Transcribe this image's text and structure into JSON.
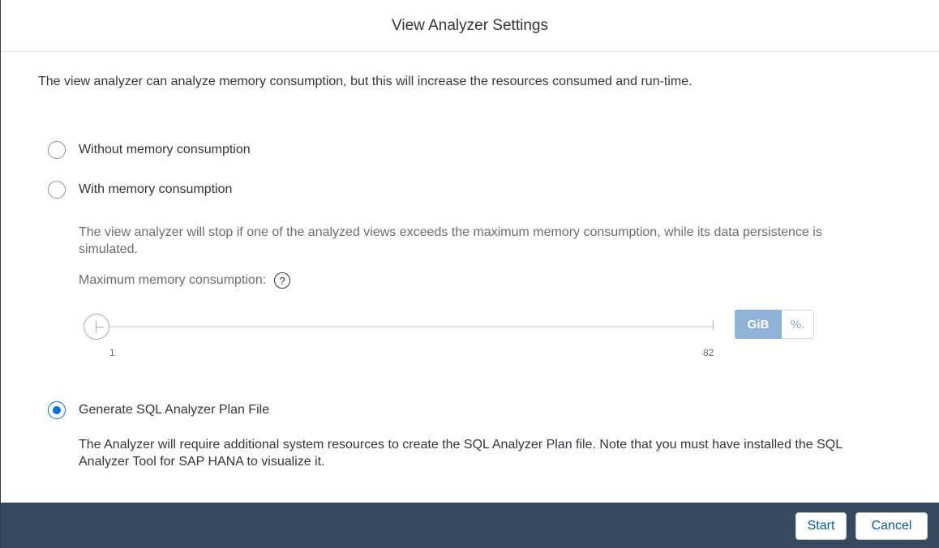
{
  "dialog": {
    "title": "View Analyzer Settings",
    "intro": "The view analyzer can analyze memory consumption, but this will increase the resources consumed and run-time."
  },
  "options": {
    "without_memory": {
      "label": "Without memory consumption",
      "selected": false
    },
    "with_memory": {
      "label": "With memory consumption",
      "selected": false
    },
    "generate_sql": {
      "label": "Generate SQL Analyzer Plan File",
      "selected": true
    }
  },
  "memory": {
    "note": "The view analyzer will stop if one of the analyzed views exceeds the maximum memory consumption, while its data persistence is simulated.",
    "max_label": "Maximum memory consumption:",
    "help_icon": "question-circle-icon",
    "slider": {
      "min": "1",
      "max": "82",
      "value": 1
    },
    "units": {
      "gib": "GiB",
      "percent": "%.",
      "selected": "GiB"
    }
  },
  "sql_note": "The Analyzer will require additional system resources to create the SQL Analyzer Plan file. Note that you must have installed the SQL Analyzer Tool for SAP HANA to visualize it.",
  "footer": {
    "start_label": "Start",
    "cancel_label": "Cancel"
  },
  "colors": {
    "footer_bg": "#354a5f",
    "accent": "#0a6ed1",
    "unit_active_bg": "#8fb3d6"
  }
}
